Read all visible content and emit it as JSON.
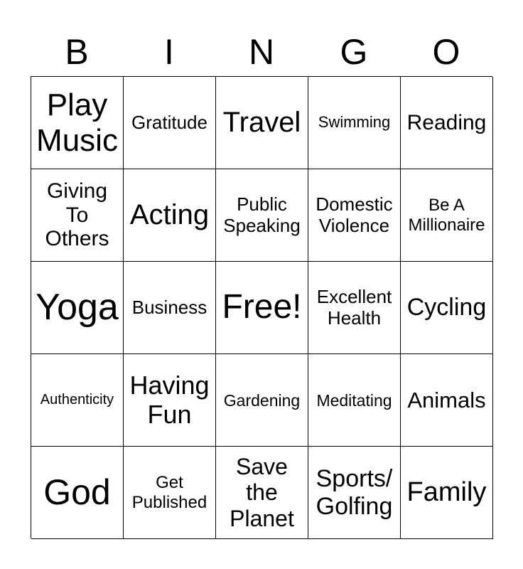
{
  "header": {
    "letters": [
      "B",
      "I",
      "N",
      "G",
      "O"
    ]
  },
  "cells": [
    "Play\nMusic",
    "Gratitude",
    "Travel",
    "Swimming",
    "Reading",
    "Giving\nTo\nOthers",
    "Acting",
    "Public\nSpeaking",
    "Domestic\nViolence",
    "Be A\nMillionaire",
    "Yoga",
    "Business",
    "Free!",
    "Excellent\nHealth",
    "Cycling",
    "Authenticity",
    "Having\nFun",
    "Gardening",
    "Meditating",
    "Animals",
    "God",
    "Get\nPublished",
    "Save\nthe\nPlanet",
    "Sports/\nGolfing",
    "Family"
  ]
}
